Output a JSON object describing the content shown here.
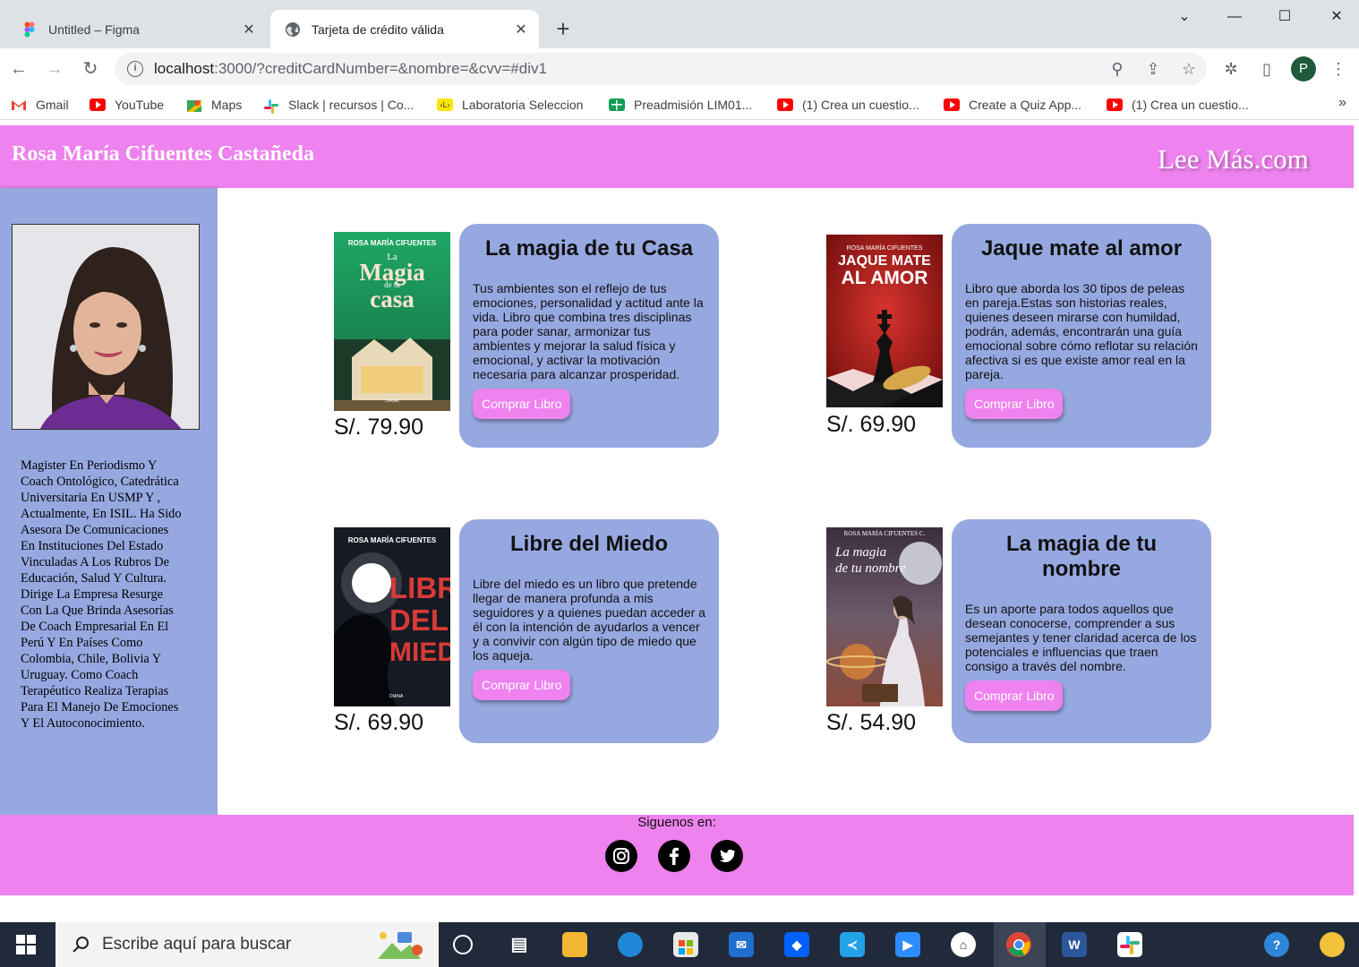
{
  "browser": {
    "tabs": [
      {
        "title": "Untitled – Figma",
        "active": false
      },
      {
        "title": "Tarjeta de crédito válida",
        "active": true
      }
    ],
    "url_host": "localhost",
    "url_rest": ":3000/?creditCardNumber=&nombre=&cvv=#div1",
    "profile_initial": "P",
    "bookmarks": [
      "Gmail",
      "YouTube",
      "Maps",
      "Slack | recursos | Co...",
      "Laboratoria Seleccion",
      "Preadmisión LIM01...",
      "(1) Crea un cuestio...",
      "Create a Quiz App...",
      "(1) Crea un cuestio..."
    ]
  },
  "site": {
    "author": "Rosa María Cifuentes Castañeda",
    "brand": "Lee Más.com",
    "bio": "Magister En Periodismo Y Coach Ontológico, Catedrática Universitaria En USMP Y , Actualmente, En ISIL. Ha Sido Asesora De Comunicaciones En Instituciones Del Estado Vinculadas A Los Rubros De Educación, Salud Y Cultura. Dirige La Empresa Resurge Con La Que Brinda Asesorías De Coach Empresarial En El Perú Y En Países Como Colombia, Chile, Bolivia Y Uruguay. Como Coach Terapéutico Realiza Terapias Para El Manejo De Emociones Y El Autoconocimiento.",
    "buy_label": "Comprar Libro",
    "books": [
      {
        "title": "La magia de tu Casa",
        "price": "S/. 79.90",
        "description": "Tus ambientes son el reflejo de tus emociones, personalidad y actitud ante la vida. Libro que combina tres disciplinas para poder sanar, armonizar tus ambientes y mejorar la salud física y emocional, y activar la motivación necesaria para alcanzar prosperidad.",
        "cover_author": "ROSA MARÍA CIFUENTES",
        "cover_title_1": "La",
        "cover_title_2": "Magia",
        "cover_title_3": "de tu",
        "cover_title_4": "casa",
        "cover_publisher": "DIANA"
      },
      {
        "title": "Jaque mate al amor",
        "price": "S/. 69.90",
        "description": "Libro que aborda los 30 tipos de peleas en pareja.Estas son historias reales, quienes deseen mirarse con humildad, podrán, además, encontrarán una guía emocional sobre cómo reflotar su relación afectiva si es que existe amor real en la pareja.",
        "cover_author": "ROSA MARÍA CIFUENTES",
        "cover_title_1": "JAQUE MATE",
        "cover_title_2": "AL AMOR"
      },
      {
        "title": "Libre del Miedo",
        "price": "S/. 69.90",
        "description": "Libre del miedo es un libro que pretende llegar de manera profunda a mis seguidores y a quienes puedan acceder a él con la intención de ayudarlos a vencer y a convivir con algún tipo de miedo que los aqueja.",
        "cover_author": "ROSA MARÍA CIFUENTES",
        "cover_title_1": "LIBRE",
        "cover_title_2": "DEL",
        "cover_title_3": "MIEDO",
        "cover_publisher": "DIANA"
      },
      {
        "title": "La magia de tu nombre",
        "price": "S/. 54.90",
        "description": "Es un aporte para todos aquellos que desean conocerse, comprender a sus semejantes y tener claridad acerca de los potenciales e influencias que traen consigo a través del nombre.",
        "cover_author": "ROSA MARÍA CIFUENTES C.",
        "cover_title_1": "La magia",
        "cover_title_2": "de tu nombre"
      }
    ],
    "follow_label": "Siguenos en:",
    "social": [
      {
        "icon": "instagram-icon",
        "glyph": "◎"
      },
      {
        "icon": "facebook-icon",
        "glyph": "f"
      },
      {
        "icon": "twitter-icon",
        "glyph": "🐦"
      }
    ]
  },
  "taskbar": {
    "search_placeholder": "Escribe aquí para buscar"
  },
  "colors": {
    "header": "#ee82ee",
    "sidebar": "#96a8e0",
    "card": "#96a8e0",
    "button": "#ee82ee"
  }
}
